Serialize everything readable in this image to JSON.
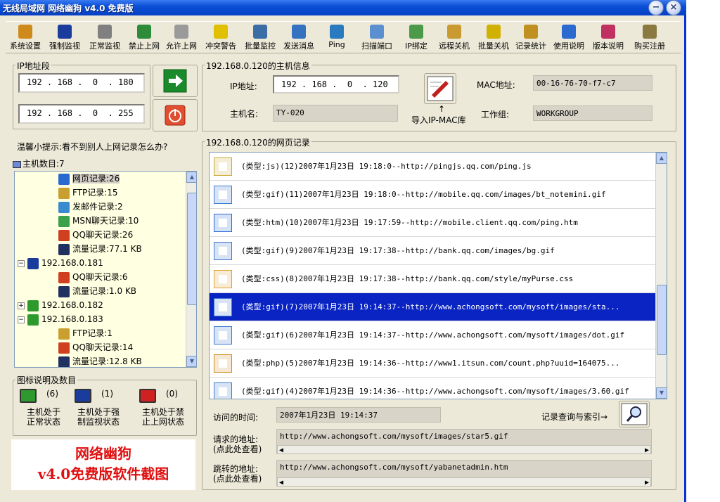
{
  "window": {
    "title": "无线局域网 网络幽狗 v4.0 免费版"
  },
  "titlebar_buttons": {
    "minimize": "−",
    "close": "×"
  },
  "toolbar": [
    {
      "label": "系统设置",
      "icon": "gear-icon",
      "color": "#d08a1c"
    },
    {
      "label": "强制监视",
      "icon": "monitor-icon",
      "color": "#1a3c9c"
    },
    {
      "label": "正常监视",
      "icon": "monitor-gray-icon",
      "color": "#808080"
    },
    {
      "label": "禁止上网",
      "icon": "block-icon",
      "color": "#2e8b3a"
    },
    {
      "label": "允许上网",
      "icon": "allow-icon",
      "color": "#9a9a9a"
    },
    {
      "label": "冲突警告",
      "icon": "warning-icon",
      "color": "#e0c000"
    },
    {
      "label": "批量监控",
      "icon": "batch-monitor-icon",
      "color": "#3a6ea5"
    },
    {
      "label": "发送消息",
      "icon": "message-icon",
      "color": "#3572c0"
    },
    {
      "label": "Ping",
      "icon": "globe-icon",
      "color": "#2a7ac0"
    },
    {
      "label": "扫描端口",
      "icon": "scan-icon",
      "color": "#5a8fd0"
    },
    {
      "label": "IP绑定",
      "icon": "ip-bind-icon",
      "color": "#4a9a4a"
    },
    {
      "label": "远程关机",
      "icon": "remote-shutdown-icon",
      "color": "#c89a30"
    },
    {
      "label": "批量关机",
      "icon": "radiation-icon",
      "color": "#d0b000"
    },
    {
      "label": "记录统计",
      "icon": "stats-icon",
      "color": "#c09020"
    },
    {
      "label": "使用说明",
      "icon": "help-icon",
      "color": "#2b6bd0"
    },
    {
      "label": "版本说明",
      "icon": "version-icon",
      "color": "#c03060"
    },
    {
      "label": "购买注册",
      "icon": "key-icon",
      "color": "#8a7a40"
    }
  ],
  "ip_range": {
    "label": "IP地址段",
    "start": "192 . 168 .  0  . 180",
    "end": "192 . 168 .  0  . 255"
  },
  "host_info": {
    "label": "192.168.0.120的主机信息",
    "ip_label": "IP地址:",
    "ip_value": "192 . 168 .  0  . 120",
    "host_label": "主机名:",
    "host_value": "TY-020",
    "import_label": "导入IP-MAC库",
    "mac_label": "MAC地址:",
    "mac_value": "00-16-76-70-f7-c7",
    "group_label": "工作组:",
    "group_value": "WORKGROUP"
  },
  "tip": "温馨小提示:看不到别人上网记录怎么办?",
  "host_count": "主机数目:7",
  "tree": [
    {
      "text": "网页记录:26",
      "indent": 3,
      "icon": "ie-icon",
      "selected": true
    },
    {
      "text": "FTP记录:15",
      "indent": 3,
      "icon": "ftp-icon"
    },
    {
      "text": "发邮件记录:2",
      "indent": 3,
      "icon": "mail-icon"
    },
    {
      "text": "MSN聊天记录:10",
      "indent": 3,
      "icon": "msn-icon"
    },
    {
      "text": "QQ聊天记录:26",
      "indent": 3,
      "icon": "qq-icon"
    },
    {
      "text": "流量记录:77.1 KB",
      "indent": 3,
      "icon": "traffic-icon"
    },
    {
      "text": "192.168.0.181",
      "indent": 1,
      "icon": "monitor-blue-icon",
      "expander": "−"
    },
    {
      "text": "QQ聊天记录:6",
      "indent": 3,
      "icon": "qq-icon"
    },
    {
      "text": "流量记录:1.0 KB",
      "indent": 3,
      "icon": "traffic-icon"
    },
    {
      "text": "192.168.0.182",
      "indent": 1,
      "icon": "monitor-green-icon",
      "expander": "+"
    },
    {
      "text": "192.168.0.183",
      "indent": 1,
      "icon": "monitor-green-icon",
      "expander": "−"
    },
    {
      "text": "FTP记录:1",
      "indent": 3,
      "icon": "ftp-icon"
    },
    {
      "text": "QQ聊天记录:14",
      "indent": 3,
      "icon": "qq-icon"
    },
    {
      "text": "流量记录:12.8 KB",
      "indent": 3,
      "icon": "traffic-icon"
    }
  ],
  "legend": {
    "label": "图标说明及数目",
    "items": [
      {
        "count": "(6)",
        "caption1": "主机处于",
        "caption2": "正常状态",
        "color": "#2e9a2e"
      },
      {
        "count": "(1)",
        "caption1": "主机处于强",
        "caption2": "制监视状态",
        "color": "#1a3c9c"
      },
      {
        "count": "(0)",
        "caption1": "主机处于禁",
        "caption2": "止上网状态",
        "color": "#d02020"
      }
    ]
  },
  "promo": {
    "line1": "网络幽狗",
    "line2": "v4.0免费版软件截图"
  },
  "web_records": {
    "label": "192.168.0.120的网页记录",
    "rows": [
      {
        "text": "(类型:js)(12)2007年1月23日  19:18:0--http://pingjs.qq.com/ping.js",
        "icon": "js-file-icon"
      },
      {
        "text": "(类型:gif)(11)2007年1月23日  19:18:0--http://mobile.qq.com/images/bt_notemini.gif",
        "icon": "image-file-icon"
      },
      {
        "text": "(类型:htm)(10)2007年1月23日  19:17:59--http://mobile.client.qq.com/ping.htm",
        "icon": "ie-icon"
      },
      {
        "text": "(类型:gif)(9)2007年1月23日  19:17:38--http://bank.qq.com/images/bg.gif",
        "icon": "image-file-icon"
      },
      {
        "text": "(类型:css)(8)2007年1月23日  19:17:38--http://bank.qq.com/style/myPurse.css",
        "icon": "css-file-icon"
      },
      {
        "text": "(类型:gif)(7)2007年1月23日  19:14:37--http://www.achongsoft.com/mysoft/images/sta...",
        "icon": "image-file-icon",
        "selected": true
      },
      {
        "text": "(类型:gif)(6)2007年1月23日  19:14:37--http://www.achongsoft.com/mysoft/images/dot.gif",
        "icon": "image-file-icon"
      },
      {
        "text": "(类型:php)(5)2007年1月23日  19:14:36--http://www1.itsun.com/count.php?uuid=164075...",
        "icon": "php-file-icon"
      },
      {
        "text": "(类型:gif)(4)2007年1月23日  19:14:36--http://www.achongsoft.com/mysoft/images/3.60.gif",
        "icon": "image-file-icon"
      }
    ]
  },
  "details": {
    "time_label": "访问的时间:",
    "time_value": "2007年1月23日  19:14:37",
    "query_label": "记录查询与索引→",
    "request_label1": "请求的地址:",
    "request_label2": "(点此处查看)",
    "request_value": "http://www.achongsoft.com/mysoft/images/star5.gif",
    "redirect_label1": "跳转的地址:",
    "redirect_label2": "(点此处查看)",
    "redirect_value": "http://www.achongsoft.com/mysoft/yabanetadmin.htm"
  }
}
